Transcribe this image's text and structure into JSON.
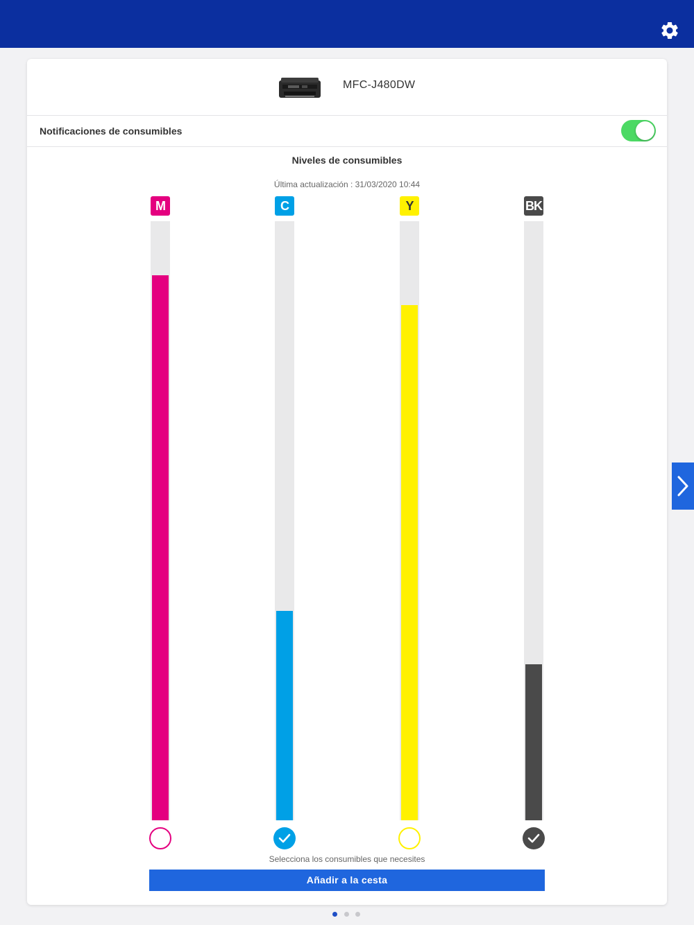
{
  "header": {
    "settings_icon": "gear-icon",
    "background": "#0b2f9f"
  },
  "printer": {
    "name": "MFC-J480DW",
    "image": "printer-icon"
  },
  "notifications": {
    "label": "Notificaciones de consumibles",
    "enabled": true,
    "toggle_color": "#4cd964"
  },
  "levels": {
    "title": "Niveles de consumibles",
    "updated": "Última actualización : 31/03/2020 10:44",
    "inks": [
      {
        "label": "M",
        "color": "#e4007f",
        "level": 0.91,
        "selected": false
      },
      {
        "label": "C",
        "color": "#00a0e6",
        "level": 0.35,
        "selected": true
      },
      {
        "label": "Y",
        "color": "#fff100",
        "level": 0.86,
        "selected": false
      },
      {
        "label": "BK",
        "color": "#4a4a4a",
        "level": 0.26,
        "selected": true
      }
    ]
  },
  "footer": {
    "hint": "Selecciona los consumibles que necesites",
    "cart_button": "Añadir a la cesta",
    "accent": "#1f66de"
  },
  "pager": {
    "count": 3,
    "active": 0
  },
  "next_icon": "chevron-right-icon"
}
